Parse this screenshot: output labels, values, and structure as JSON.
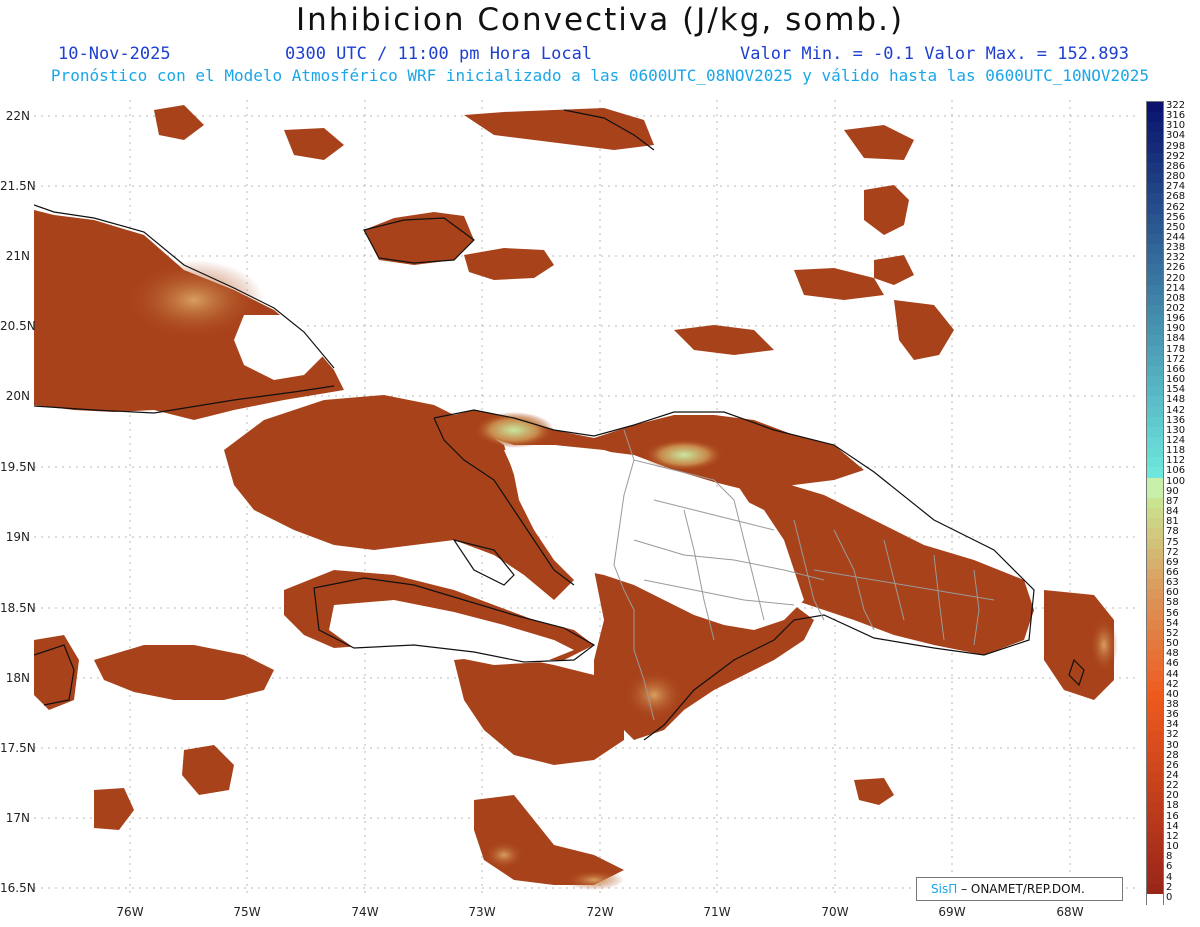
{
  "header": {
    "title": "Inhibicion Convectiva (J/kg, somb.)",
    "date": "10-Nov-2025",
    "time": "0300 UTC / 11:00 pm Hora Local",
    "minmax": "Valor Min. = -0.1  Valor Max. = 152.893",
    "model_line": "Pronóstico con el Modelo Atmosférico WRF inicializado a las 0600UTC_08NOV2025 y válido hasta las  0600UTC_10NOV2025"
  },
  "axes": {
    "lat_labels": [
      "22N",
      "21.5N",
      "21N",
      "20.5N",
      "20N",
      "19.5N",
      "19N",
      "18.5N",
      "18N",
      "17.5N",
      "17N",
      "16.5N"
    ],
    "lon_labels": [
      "76W",
      "75W",
      "74W",
      "73W",
      "72W",
      "71W",
      "70W",
      "69W",
      "68W"
    ]
  },
  "colorbar": {
    "labels": [
      "322",
      "316",
      "310",
      "304",
      "298",
      "292",
      "286",
      "280",
      "274",
      "268",
      "262",
      "256",
      "250",
      "244",
      "238",
      "232",
      "226",
      "220",
      "214",
      "208",
      "202",
      "196",
      "190",
      "184",
      "178",
      "172",
      "166",
      "160",
      "154",
      "148",
      "142",
      "136",
      "130",
      "124",
      "118",
      "112",
      "106",
      "100",
      "90",
      "87",
      "84",
      "81",
      "78",
      "75",
      "72",
      "69",
      "66",
      "63",
      "60",
      "58",
      "56",
      "54",
      "52",
      "50",
      "48",
      "46",
      "44",
      "42",
      "40",
      "38",
      "36",
      "34",
      "32",
      "30",
      "28",
      "26",
      "24",
      "22",
      "20",
      "18",
      "16",
      "14",
      "12",
      "10",
      "8",
      "6",
      "4",
      "2",
      "0"
    ]
  },
  "colors": {
    "field_dark": "#8a2a10",
    "field_mid": "#a8421a",
    "field_light": "#c8703a",
    "coast": "#111111",
    "provinces": "#9a9a9a"
  },
  "credit": {
    "sis": "SisΠ",
    "text": "– ONAMET/REP.DOM."
  }
}
